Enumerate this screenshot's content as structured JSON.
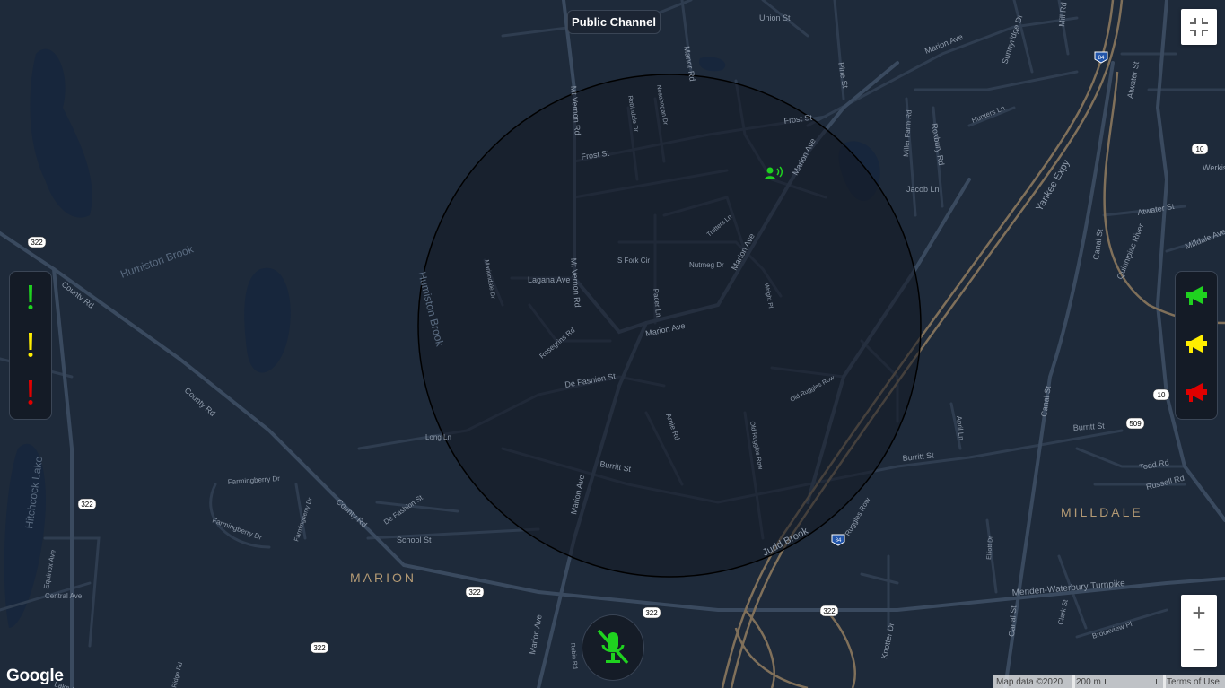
{
  "header": {
    "channel_label": "Public Channel"
  },
  "map": {
    "streets": {
      "union_st": "Union St",
      "marion_ave_top": "Marion Ave",
      "sunnyridge_dr": "Sunnyridge Dr",
      "mill_rd": "Mill Rd",
      "manor_rd": "Manor Rd",
      "pine_st": "Pine St",
      "atwater_st": "Atwater St",
      "atwater_st_2": "Atwater St",
      "mt_vernon_rd_top": "Mt Vernon Rd",
      "mt_vernon_rd_mid": "Mt Vernon Rd",
      "robindale_dr": "Robindale Dr",
      "nosahogan_dr": "Nosahogan Dr",
      "frost_st_left": "Frost St",
      "frost_st_right": "Frost St",
      "marion_ave_ne": "Marion Ave",
      "marion_ave_mid": "Marion Ave",
      "marion_ave_center": "Marion Ave",
      "marion_ave_south": "Marion Ave",
      "marion_ave_bottom": "Marion Ave",
      "miller_farm_rd": "Miller Farm Rd",
      "roxbury_rd": "Roxbury Rd",
      "hunters_ln": "Hunters Ln",
      "jacob_ln": "Jacob Ln",
      "yankee_expy": "Yankee Expy",
      "canal_st_1": "Canal St",
      "canal_st_2": "Canal St",
      "canal_st_3": "Canal St",
      "quinnipiac_river": "Quinnipiac River",
      "milldale_ave": "Milldale Ave",
      "werkis": "Werkis",
      "trotters_ln": "Trotters Ln",
      "s_fork_cir": "S Fork Cir",
      "nutmeg_dr": "Nutmeg Dr",
      "lagana_ave": "Lagana Ave",
      "mariondale_dr": "Mariondale Dr",
      "pacer_ln": "Pacer Ln",
      "wright_pl": "Wright Pl",
      "rosegrins_rd": "Rosegrins Rd",
      "de_fashion_st": "De Fashion St",
      "de_fashion_st_2": "De Fashion St",
      "old_ruggles_row": "Old Ruggles Row",
      "old_ruggles_row_2": "Old Ruggles Row",
      "arnie_rd": "Arnie Rd",
      "long_ln": "Long Ln",
      "burritt_st_1": "Burritt St",
      "burritt_st_2": "Burritt St",
      "burritt_st_3": "Burritt St",
      "april_ln": "April Ln",
      "todd_rd": "Todd Rd",
      "russell_rd": "Russell Rd",
      "county_rd_1": "County Rd",
      "county_rd_2": "County Rd",
      "county_rd_3": "County Rd",
      "farmingberry_dr_1": "Farmingberry Dr",
      "farmingberry_dr_2": "Farmingberry Dr",
      "farmingberry_dr_3": "Farmingberry Dr",
      "school_st": "School St",
      "judd_brook": "Judd Brook",
      "ruggles_row": "Ruggles Row",
      "elliott_dr": "Elliott Dr",
      "meriden_waterbury_tpke": "Meriden-Waterbury Turnpike",
      "clark_st": "Clark St",
      "brookview_pl": "Brookview Pl",
      "knotter_dr": "Knotter Dr",
      "robin_rd": "Robin Rd",
      "equinox_ave": "Equinox Ave",
      "central_ave": "Central Ave",
      "ridge_rd": "Ridge Rd",
      "lake_ave": "Lake Ave"
    },
    "water": {
      "humiston_brook_1": "Humiston Brook",
      "humiston_brook_2": "Humiston Brook",
      "hitchcock_lake": "Hitchcock Lake"
    },
    "places": {
      "marion": "MARION",
      "milldale": "MILLDALE"
    },
    "shields": {
      "i84_a": "84",
      "i84_b": "84",
      "r322_a": "322",
      "r322_b": "322",
      "r322_c": "322",
      "r322_d": "322",
      "r322_e": "322",
      "r322_f": "322",
      "r10_a": "10",
      "r10_b": "10",
      "r509": "509"
    },
    "colors": {
      "background": "#1e2a3a",
      "road": "#2f3d50",
      "highway": "#80705a",
      "water": "#17263c",
      "range_circle": "#141a24"
    }
  },
  "controls": {
    "alerts": [
      {
        "name": "alert-green",
        "color": "#1fd21f",
        "icon": "exclamation-icon"
      },
      {
        "name": "alert-yellow",
        "color": "#ffee00",
        "icon": "exclamation-icon"
      },
      {
        "name": "alert-red",
        "color": "#e00000",
        "icon": "exclamation-icon"
      }
    ],
    "megaphones": [
      {
        "name": "broadcast-green",
        "color": "#1fd21f",
        "icon": "megaphone-icon"
      },
      {
        "name": "broadcast-yellow",
        "color": "#ffee00",
        "icon": "megaphone-icon"
      },
      {
        "name": "broadcast-red",
        "color": "#e00000",
        "icon": "megaphone-icon"
      }
    ],
    "mic": {
      "icon": "microphone-muted-icon",
      "color": "#1fd21f"
    },
    "zoom_in": "+",
    "zoom_out": "−"
  },
  "footer": {
    "logo": "Google",
    "map_data": "Map data ©2020",
    "scale": "200 m",
    "terms": "Terms of Use"
  }
}
